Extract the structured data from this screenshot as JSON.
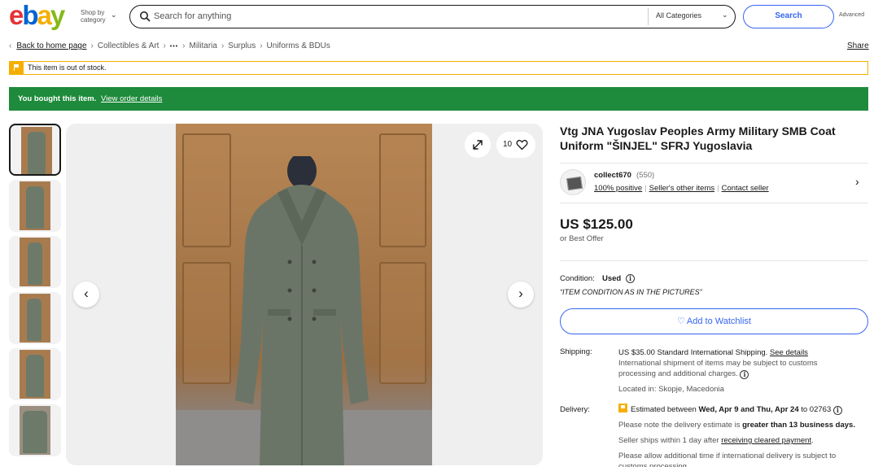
{
  "header": {
    "logo": [
      "e",
      "b",
      "a",
      "y"
    ],
    "shop_by": "Shop by category",
    "search_placeholder": "Search for anything",
    "category": "All Categories",
    "search_button": "Search",
    "advanced": "Advanced"
  },
  "breadcrumb": {
    "back": "Back to home page",
    "items": [
      "Collectibles & Art",
      "Militaria",
      "Surplus",
      "Uniforms & BDUs"
    ],
    "ellipsis": "•••",
    "share": "Share"
  },
  "alerts": {
    "out_of_stock": "This item is out of stock.",
    "bought": "You bought this item.",
    "view_order": "View order details"
  },
  "gallery": {
    "thumbnail_count": 6,
    "watch_count": "10"
  },
  "item": {
    "title": "Vtg JNA Yugoslav Peoples Army Military SMB Coat Uniform \"ŠINJEL\" SFRJ Yugoslavia",
    "seller": {
      "name": "collect670",
      "feedback_count": "(550)",
      "positive": "100% positive",
      "other_items": "Seller's other items",
      "contact": "Contact seller"
    },
    "price": "US $125.00",
    "best_offer": "or Best Offer",
    "condition_label": "Condition:",
    "condition_value": "Used",
    "condition_desc": "“ITEM CONDITION AS IN THE PICTURES”",
    "watchlist_button": "Add to Watchlist"
  },
  "shipping": {
    "label": "Shipping:",
    "cost": "US $35.00 Standard International Shipping.",
    "see_details": "See details",
    "note": "International shipment of items may be subject to customs processing and additional charges.",
    "location": "Located in: Skopje, Macedonia"
  },
  "delivery": {
    "label": "Delivery:",
    "estimate_prefix": "Estimated between",
    "date_range": "Wed, Apr 9 and Thu, Apr 24",
    "to_zip": "to 02763",
    "note_prefix": "Please note the delivery estimate is",
    "note_bold": "greater than 13 business days.",
    "ships_prefix": "Seller ships within 1 day after",
    "ships_link": "receiving cleared payment",
    "ships_suffix": ".",
    "allow": "Please allow additional time if international delivery is subject to customs processing."
  },
  "colors": {
    "accent": "#3665f3",
    "success": "#1e8a3b",
    "warning": "#f5af02"
  }
}
